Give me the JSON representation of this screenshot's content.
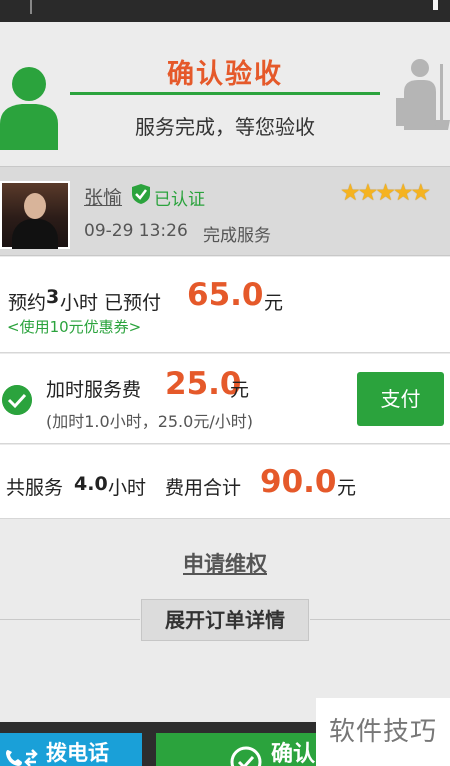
{
  "header": {
    "title": "确认验收",
    "subtitle": "服务完成，等您验收"
  },
  "worker": {
    "name": "张愉",
    "verified_label": "已认证",
    "stars": "★★★★★",
    "rating": 5,
    "datetime": "09-29 13:26",
    "status": "完成服务"
  },
  "booking": {
    "prefix": "预约",
    "hours": "3",
    "hours_unit": "小时 已预付",
    "amount": "65.0",
    "currency": "元",
    "coupon": "<使用10元优惠券>"
  },
  "extra": {
    "label": "加时服务费",
    "amount": "25.0",
    "currency": "元",
    "detail": "(加时1.0小时，25.0元/小时)",
    "pay_label": "支付"
  },
  "total": {
    "prefix": "共服务",
    "hours": "4.0",
    "hours_unit": "小时",
    "label": "费用合计",
    "amount": "90.0",
    "currency": "元"
  },
  "actions": {
    "complaint": "申请维权",
    "expand": "展开订单详情",
    "call": "拨电话",
    "confirm": "确认"
  },
  "watermark": "软件技巧",
  "colors": {
    "accent_orange": "#e5592a",
    "brand_green": "#2ba33d",
    "call_blue": "#1aa0d8"
  }
}
